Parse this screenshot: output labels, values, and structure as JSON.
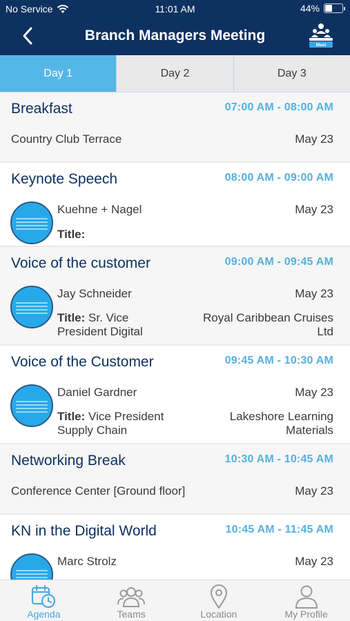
{
  "status_bar": {
    "carrier": "No Service",
    "time": "11:01 AM",
    "battery_percent": "44%",
    "battery_level": 0.44
  },
  "header": {
    "title": "Branch Managers Meeting",
    "back_icon": "chevron-left-icon",
    "logo_text": "Meet"
  },
  "tabs": [
    {
      "label": "Day 1",
      "active": true
    },
    {
      "label": "Day 2",
      "active": false
    },
    {
      "label": "Day 3",
      "active": false
    }
  ],
  "agenda": [
    {
      "title": "Breakfast",
      "time": "07:00 AM - 08:00 AM",
      "location": "Country Club Terrace",
      "date": "May 23"
    },
    {
      "title": "Keynote Speech",
      "time": "08:00 AM - 09:00 AM",
      "speaker": "Kuehne + Nagel",
      "title_label": "Title:",
      "role": "",
      "company": "",
      "date": "May 23"
    },
    {
      "title": "Voice of the customer",
      "time": "09:00 AM - 09:45 AM",
      "speaker": "Jay Schneider",
      "title_label": "Title:",
      "role": "Sr. Vice President Digital",
      "company": "Royal Caribbean Cruises Ltd",
      "date": "May 23"
    },
    {
      "title": "Voice of the Customer",
      "time": "09:45 AM - 10:30 AM",
      "speaker": "Daniel Gardner",
      "title_label": "Title:",
      "role": "Vice President Supply Chain",
      "company": "Lakeshore Learning Materials",
      "date": "May 23"
    },
    {
      "title": "Networking Break",
      "time": "10:30 AM - 10:45 AM",
      "location": "Conference Center [Ground floor]",
      "date": "May 23"
    },
    {
      "title": "KN in the Digital World",
      "time": "10:45 AM - 11:45 AM",
      "speaker": "Marc Strolz",
      "date": "May 23"
    }
  ],
  "bottom_nav": [
    {
      "label": "Agenda",
      "icon": "calendar-clock-icon",
      "active": true
    },
    {
      "label": "Teams",
      "icon": "people-icon",
      "active": false
    },
    {
      "label": "Location",
      "icon": "map-pin-icon",
      "active": false
    },
    {
      "label": "My Profile",
      "icon": "person-icon",
      "active": false
    }
  ],
  "colors": {
    "header_bg": "#0d3160",
    "tab_active": "#55b7e8",
    "time_accent": "#56b0e0",
    "title_text": "#0d3160",
    "avatar_bg": "#27a9e9"
  }
}
